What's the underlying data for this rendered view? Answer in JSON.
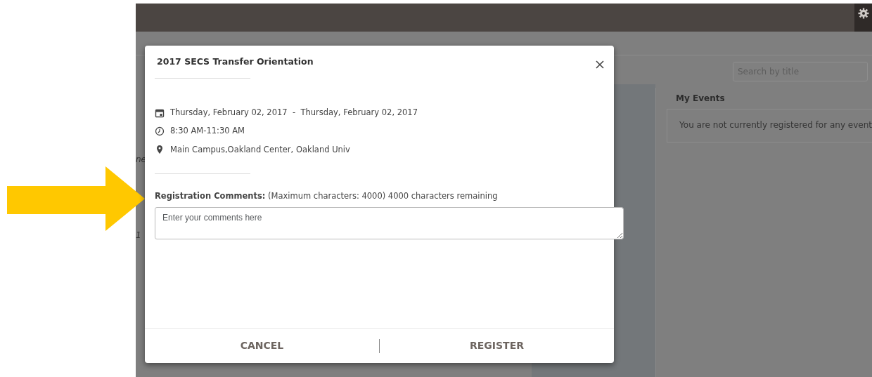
{
  "background_page": {
    "search": {
      "placeholder": "Search by title"
    },
    "my_events": {
      "heading": "My Events",
      "message": "You are not currently registered for any event"
    },
    "fragments": [
      "ne",
      "1"
    ]
  },
  "modal": {
    "title": "2017 SECS Transfer Orientation",
    "details": [
      {
        "kind": "date",
        "text": "Thursday, February 02, 2017  -  Thursday, February 02, 2017"
      },
      {
        "kind": "time",
        "text": "8:30 AM-11:30 AM"
      },
      {
        "kind": "location",
        "text": "Main Campus,Oakland Center, Oakland Univ"
      }
    ],
    "comments": {
      "label": "Registration Comments:",
      "note": "(Maximum characters: 4000) 4000 characters remaining",
      "placeholder": "Enter your comments here"
    },
    "buttons": [
      "CANCEL",
      "REGISTER"
    ]
  }
}
